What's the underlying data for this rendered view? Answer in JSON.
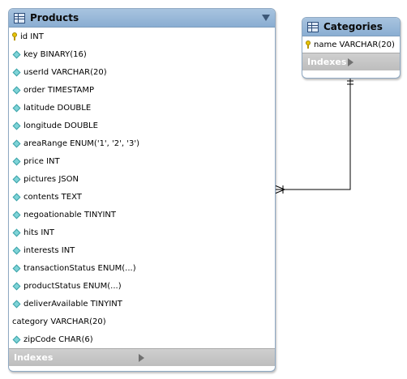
{
  "products": {
    "title": "Products",
    "columns": [
      {
        "text": "id INT",
        "icon": "key-icon"
      },
      {
        "text": "key BINARY(16)",
        "icon": "diamond-icon"
      },
      {
        "text": "userId VARCHAR(20)",
        "icon": "diamond-icon"
      },
      {
        "text": "order TIMESTAMP",
        "icon": "diamond-icon"
      },
      {
        "text": "latitude DOUBLE",
        "icon": "diamond-icon"
      },
      {
        "text": "longitude DOUBLE",
        "icon": "diamond-icon"
      },
      {
        "text": "areaRange ENUM('1', '2', '3')",
        "icon": "diamond-icon"
      },
      {
        "text": "price INT",
        "icon": "diamond-icon"
      },
      {
        "text": "pictures JSON",
        "icon": "diamond-icon"
      },
      {
        "text": "contents TEXT",
        "icon": "diamond-icon"
      },
      {
        "text": "negoationable TINYINT",
        "icon": "diamond-icon"
      },
      {
        "text": "hits INT",
        "icon": "diamond-icon"
      },
      {
        "text": "interests INT",
        "icon": "diamond-icon"
      },
      {
        "text": "transactionStatus ENUM(...)",
        "icon": "diamond-icon"
      },
      {
        "text": "productStatus ENUM(...)",
        "icon": "diamond-icon"
      },
      {
        "text": "deliverAvailable TINYINT",
        "icon": "diamond-icon"
      },
      {
        "text": "category VARCHAR(20)",
        "icon": ""
      },
      {
        "text": "zipCode CHAR(6)",
        "icon": "diamond-icon"
      }
    ],
    "indexes_label": "Indexes"
  },
  "categories": {
    "title": "Categories",
    "columns": [
      {
        "text": "name VARCHAR(20)",
        "icon": "key-icon"
      }
    ],
    "indexes_label": "Indexes"
  },
  "relationship": {
    "from": "Categories",
    "to": "Products",
    "cardinality": "one-to-many"
  }
}
